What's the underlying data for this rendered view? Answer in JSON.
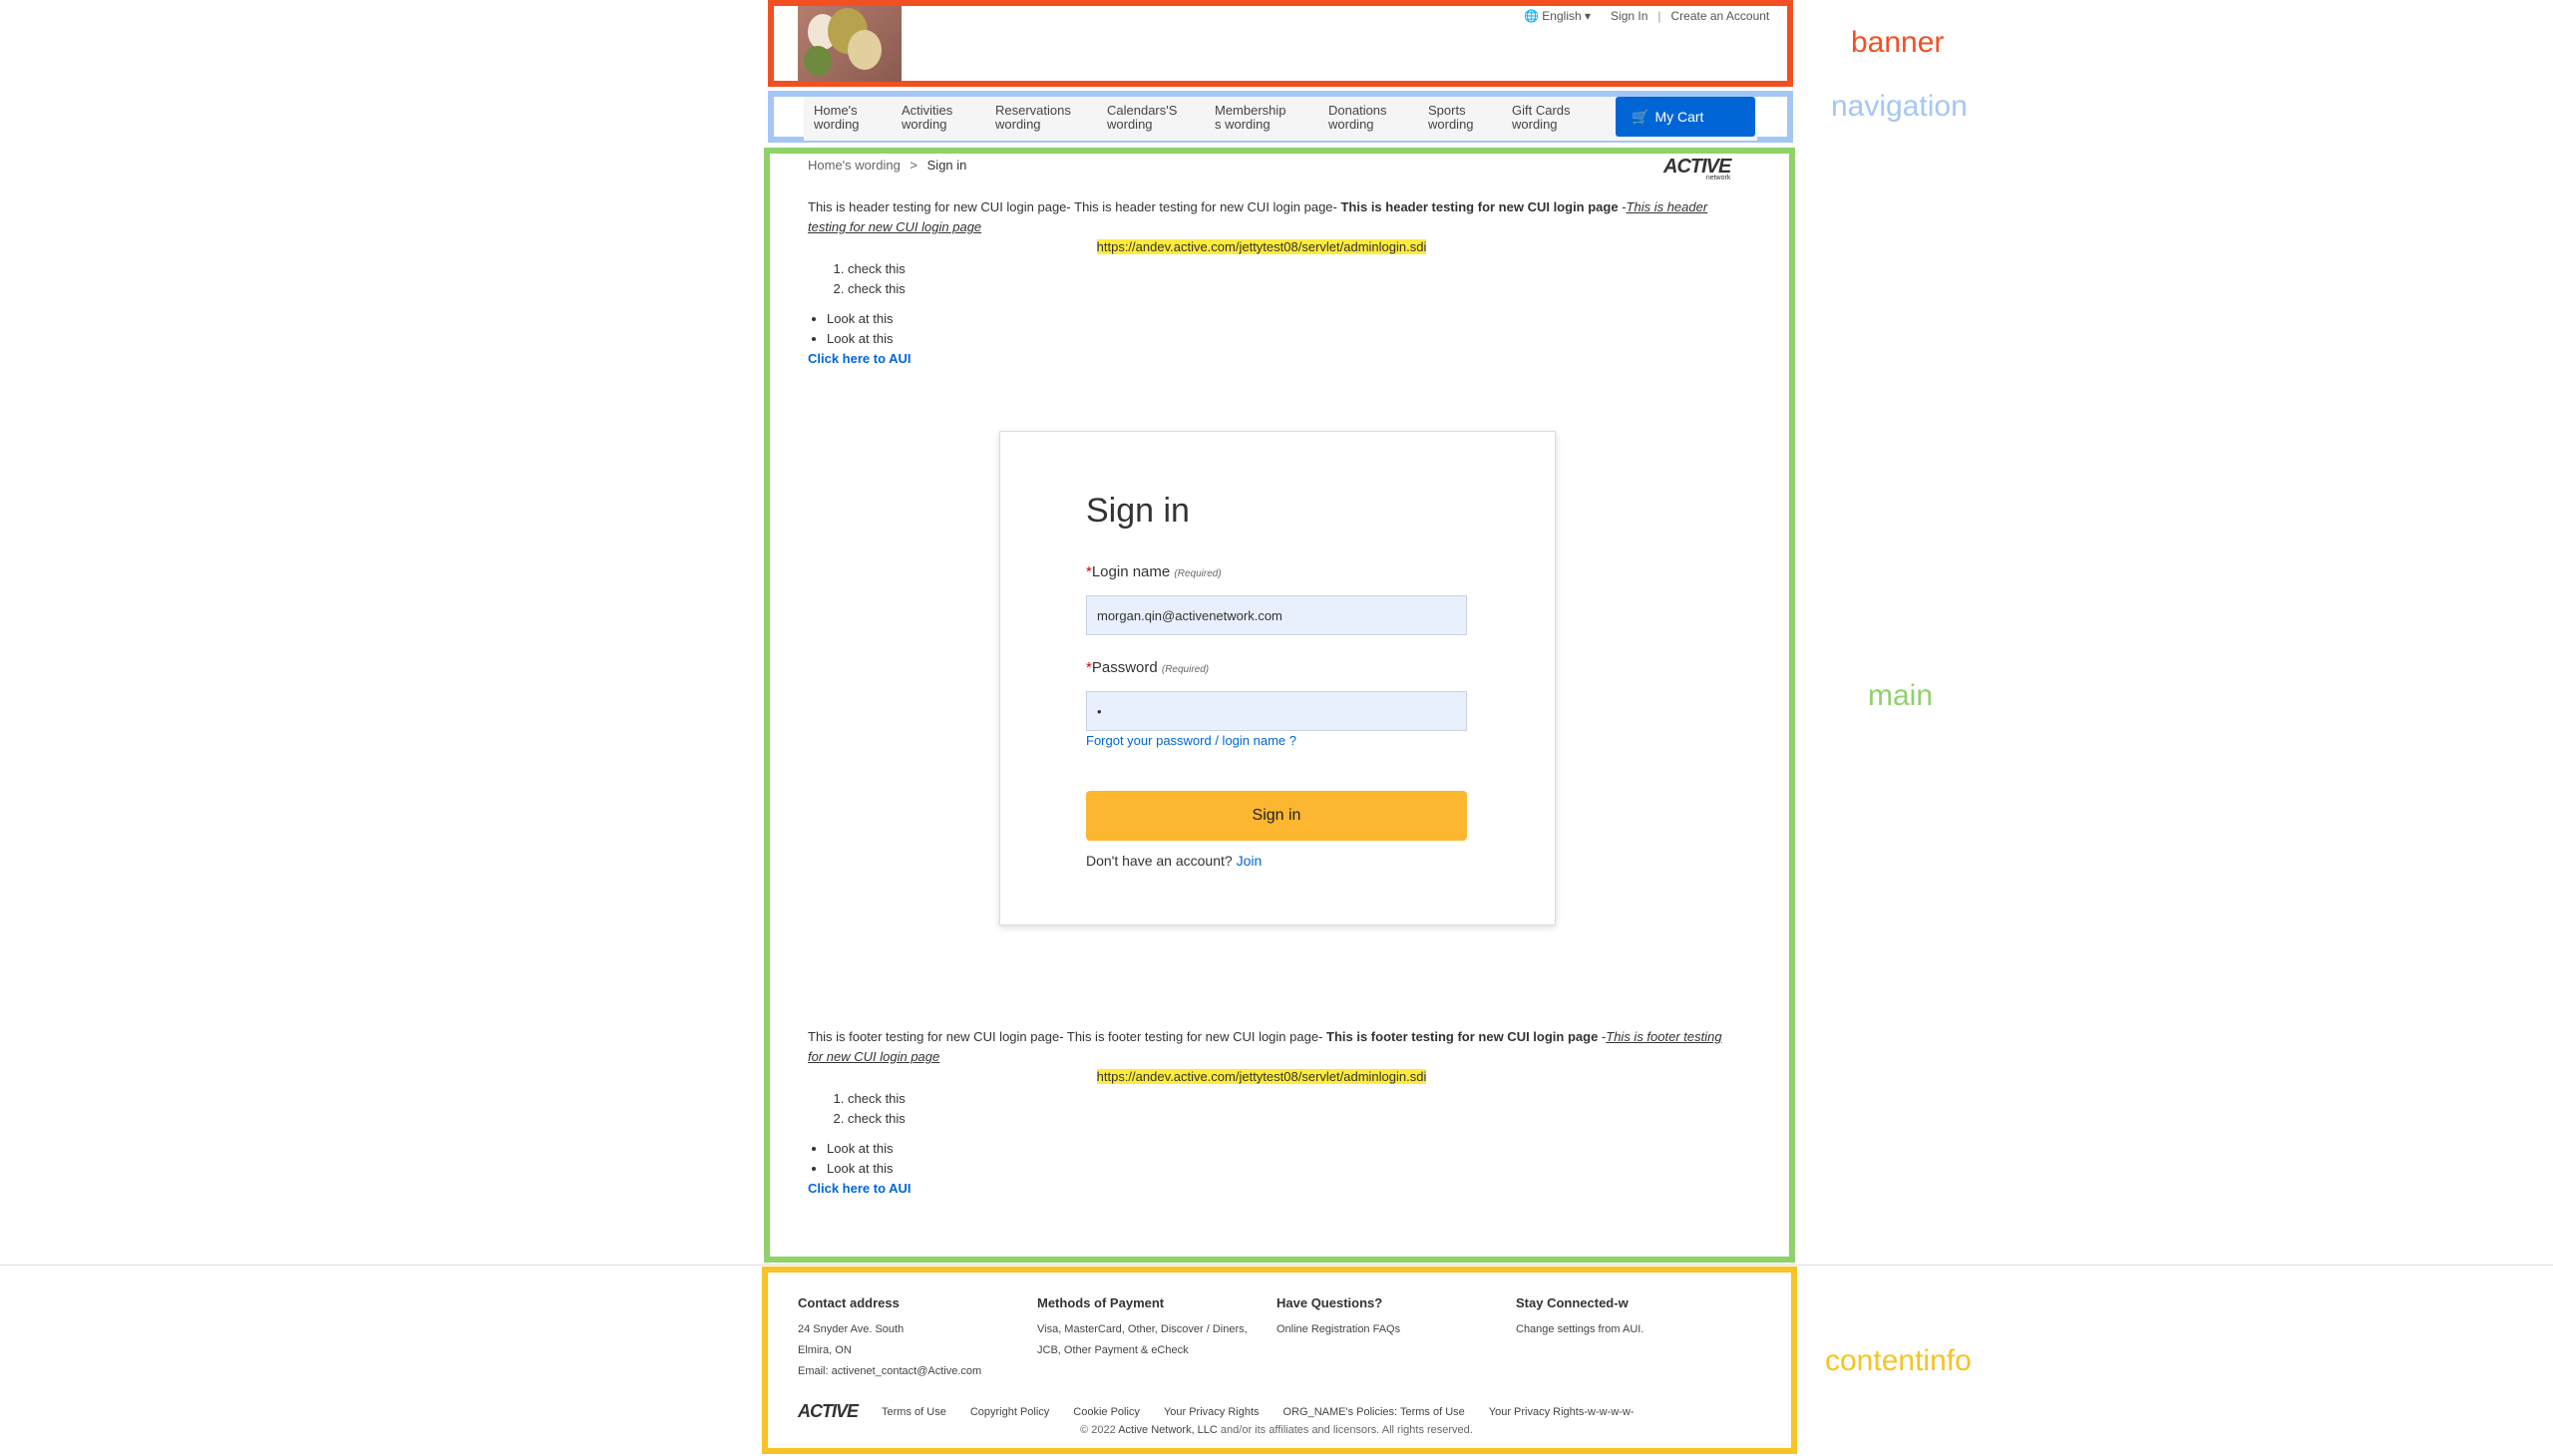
{
  "annotations": {
    "banner": "banner",
    "navigation": "navigation",
    "main": "main",
    "contentinfo": "contentinfo"
  },
  "header": {
    "language": "English",
    "sign_in": "Sign In",
    "separator": "|",
    "create_account": "Create an Account"
  },
  "nav": {
    "items": [
      {
        "line1": "Home's",
        "line2": "wording"
      },
      {
        "line1": "Activities",
        "line2": "wording"
      },
      {
        "line1": "Reservations",
        "line2": "wording"
      },
      {
        "line1": "Calendars'S",
        "line2": "wording"
      },
      {
        "line1": "Membership",
        "line2": "s wording"
      },
      {
        "line1": "Donations",
        "line2": "wording"
      },
      {
        "line1": "Sports",
        "line2": "wording"
      },
      {
        "line1": "Gift Cards",
        "line2": "wording"
      }
    ],
    "cart": "My Cart"
  },
  "breadcrumb": {
    "home": "Home's wording",
    "sep": ">",
    "current": "Sign in"
  },
  "brand": {
    "name": "ACTIVE",
    "sub": "network"
  },
  "header_content": {
    "normal": "This is header testing for new CUI login page- This is header testing for new CUI login page- ",
    "bold": "This is header testing for new CUI login page",
    "dash": " -",
    "italic": "This is header testing for new CUI login page",
    "url": "https://andev.active.com/jettytest08/servlet/adminlogin.sdi",
    "ol": [
      "check this",
      "check this"
    ],
    "ul": [
      "Look at this",
      "Look at this"
    ],
    "link": "Click here to AUI"
  },
  "signin": {
    "title": "Sign in",
    "login_label": "Login name",
    "login_required": "(Required)",
    "login_value": "morgan.qin@activenetwork.com",
    "password_label": "Password",
    "password_required": "(Required)",
    "password_value": "•",
    "forgot": "Forgot your password / login name ?",
    "button": "Sign in",
    "no_account": "Don't have an account?",
    "join": "Join"
  },
  "footer_content": {
    "normal": "This is footer testing for new CUI login page- This is footer testing for new CUI login page- ",
    "bold": "This is footer testing for new CUI login page",
    "dash": " -",
    "italic": "This is footer testing for new CUI login page",
    "url": "https://andev.active.com/jettytest08/servlet/adminlogin.sdi",
    "ol": [
      "check this",
      "check this"
    ],
    "ul": [
      "Look at this",
      "Look at this"
    ],
    "link": "Click here to AUI"
  },
  "footer": {
    "contact": {
      "title": "Contact address",
      "line1": "24 Snyder Ave. South",
      "line2": "Elmira, ON",
      "email": "Email: activenet_contact@Active.com"
    },
    "payment": {
      "title": "Methods of Payment",
      "line1": "Visa, MasterCard, Other, Discover / Diners,",
      "line2": "JCB, Other Payment & eCheck"
    },
    "questions": {
      "title": "Have Questions?",
      "link": "Online Registration FAQs"
    },
    "stay": {
      "title": "Stay Connected-w",
      "text": "Change settings from ",
      "link": "AUI",
      "dot": "."
    },
    "links": {
      "terms": "Terms of Use",
      "copyright": "Copyright Policy",
      "cookie": "Cookie Policy",
      "privacy": "Your Privacy Rights",
      "org_policies": "ORG_NAME's Policies:",
      "org_terms": "Terms of Use",
      "privacy2": "Your Privacy Rights-w-w-w-w-"
    },
    "copyright_pre": "© 2022 ",
    "copyright_link": "Active Network, LLC",
    "copyright_post": " and/or its affiliates and licensors. All rights reserved."
  }
}
